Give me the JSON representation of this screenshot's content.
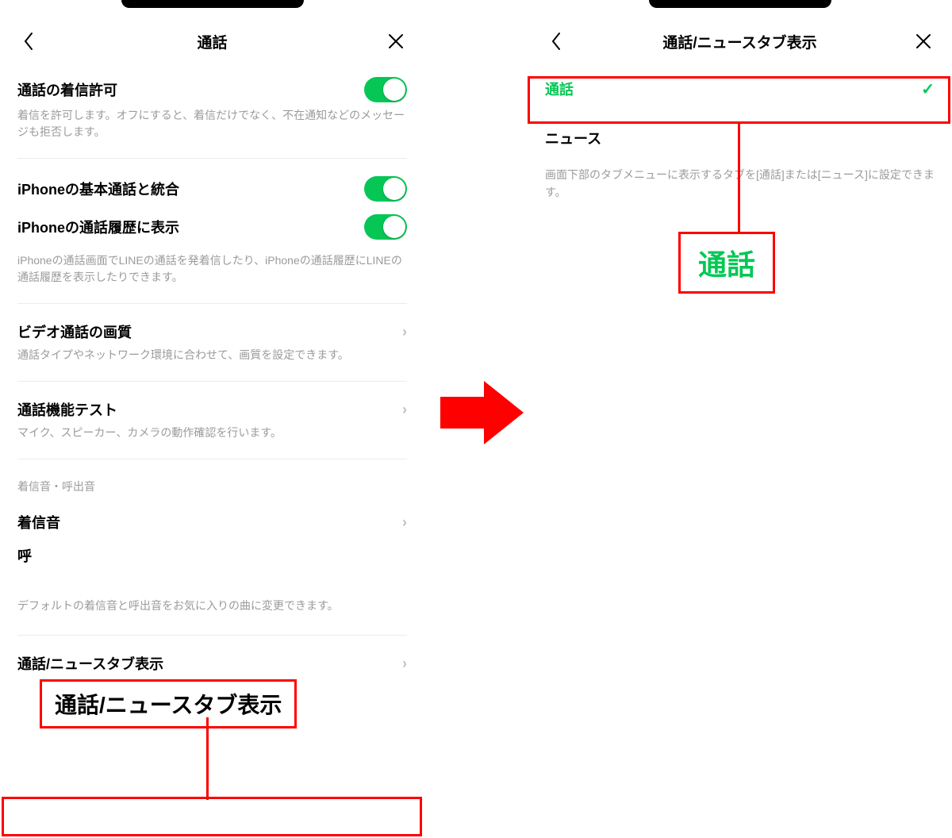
{
  "colors": {
    "accent": "#06c755",
    "highlight": "#ff0000",
    "muted": "#9b9b9b"
  },
  "left": {
    "title": "通話",
    "items": [
      {
        "title": "通話の着信許可",
        "desc": "着信を許可します。オフにすると、着信だけでなく、不在通知などのメッセージも拒否します。",
        "toggle": true
      },
      {
        "title": "iPhoneの基本通話と統合",
        "toggle": true
      },
      {
        "title": "iPhoneの通話履歴に表示",
        "toggle": true,
        "desc": "iPhoneの通話画面でLINEの通話を発着信したり、iPhoneの通話履歴にLINEの通話履歴を表示したりできます。"
      },
      {
        "title": "ビデオ通話の画質",
        "desc": "通話タイプやネットワーク環境に合わせて、画質を設定できます。",
        "chevron": true
      },
      {
        "title": "通話機能テスト",
        "desc": "マイク、スピーカー、カメラの動作確認を行います。",
        "chevron": true
      }
    ],
    "section_label": "着信音・呼出音",
    "ringtone_label": "着信音",
    "call_out_prefix": "呼",
    "sound_desc": "デフォルトの着信音と呼出音をお気に入りの曲に変更できます。",
    "tab_display_label": "通話/ニュースタブ表示",
    "callout_overlay": "通話/ニュースタブ表示"
  },
  "right": {
    "title": "通話/ニュースタブ表示",
    "options": [
      {
        "label": "通話",
        "selected": true
      },
      {
        "label": "ニュース",
        "selected": false
      }
    ],
    "desc": "画面下部のタブメニューに表示するタブを[通話]または[ニュース]に設定できます。",
    "callout_overlay": "通話"
  }
}
